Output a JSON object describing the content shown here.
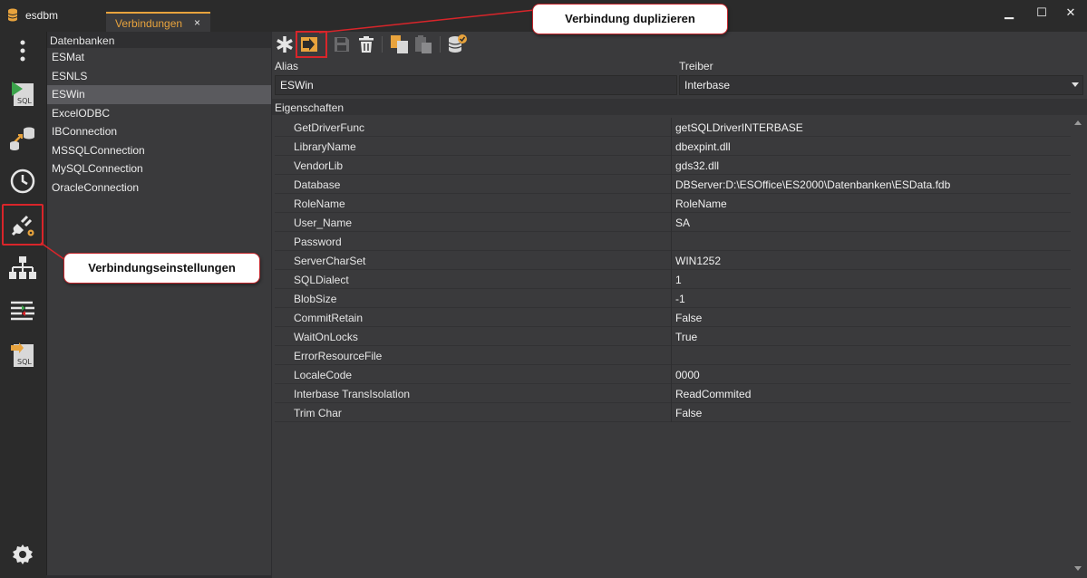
{
  "app": {
    "name": "esdbm"
  },
  "tabs": [
    {
      "label": "Verbindungen",
      "close": "×"
    }
  ],
  "window": {
    "minimize": "▁",
    "maximize": "☐",
    "close": "✕"
  },
  "db_list": {
    "header": "Datenbanken",
    "items": [
      {
        "label": "ESMat"
      },
      {
        "label": "ESNLS"
      },
      {
        "label": "ESWin"
      },
      {
        "label": "ExcelODBC"
      },
      {
        "label": "IBConnection"
      },
      {
        "label": "MSSQLConnection"
      },
      {
        "label": "MySQLConnection"
      },
      {
        "label": "OracleConnection"
      }
    ],
    "selected": "ESWin"
  },
  "form": {
    "alias_label": "Alias",
    "alias_value": "ESWin",
    "driver_label": "Treiber",
    "driver_value": "Interbase",
    "props_header": "Eigenschaften"
  },
  "properties": [
    {
      "name": "GetDriverFunc",
      "value": "getSQLDriverINTERBASE"
    },
    {
      "name": "LibraryName",
      "value": "dbexpint.dll"
    },
    {
      "name": "VendorLib",
      "value": "gds32.dll"
    },
    {
      "name": "Database",
      "value": "DBServer:D:\\ESOffice\\ES2000\\Datenbanken\\ESData.fdb"
    },
    {
      "name": "RoleName",
      "value": "RoleName"
    },
    {
      "name": "User_Name",
      "value": "SA"
    },
    {
      "name": "Password",
      "value": ""
    },
    {
      "name": "ServerCharSet",
      "value": "WIN1252"
    },
    {
      "name": "SQLDialect",
      "value": "1"
    },
    {
      "name": "BlobSize",
      "value": "-1"
    },
    {
      "name": "CommitRetain",
      "value": "False"
    },
    {
      "name": "WaitOnLocks",
      "value": "True"
    },
    {
      "name": "ErrorResourceFile",
      "value": ""
    },
    {
      "name": "LocaleCode",
      "value": "0000"
    },
    {
      "name": "Interbase TransIsolation",
      "value": "ReadCommited"
    },
    {
      "name": "Trim Char",
      "value": "False"
    }
  ],
  "callouts": {
    "duplicate": "Verbindung duplizieren",
    "settings": "Verbindungseinstellungen"
  },
  "colors": {
    "accent": "#e8a33d",
    "highlight": "#d9252a",
    "panel": "#3a3a3c",
    "chrome": "#2b2b2b"
  },
  "icons": {
    "sidebar": [
      "more-vert-icon",
      "sql-run-icon",
      "transfer-db-icon",
      "history-icon",
      "plug-settings-icon",
      "hierarchy-icon",
      "list-compare-icon",
      "sql-export-icon",
      "settings-gear-icon"
    ],
    "toolbar": [
      "new-asterisk-icon",
      "duplicate-icon",
      "save-icon",
      "delete-trash-icon",
      "copy-icon",
      "paste-icon",
      "test-db-icon"
    ]
  }
}
